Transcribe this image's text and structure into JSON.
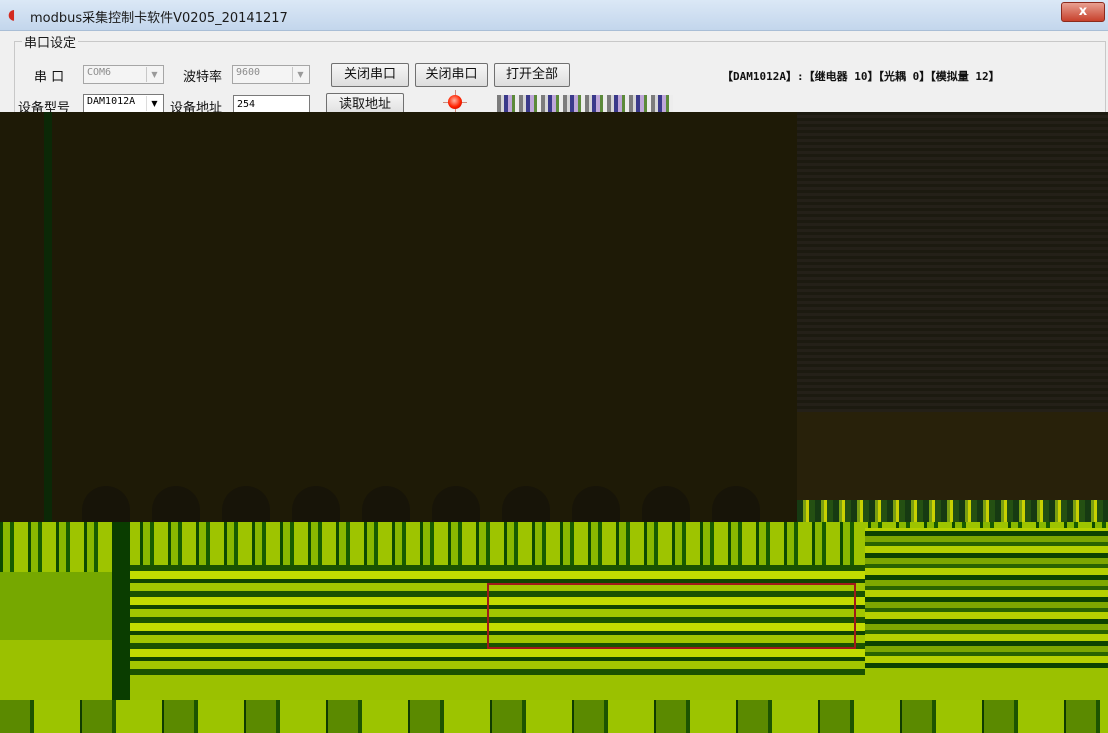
{
  "window": {
    "title": "modbus采集控制卡软件V0205_20141217",
    "close_glyph": "x"
  },
  "serial_group": {
    "title": "串口设定",
    "port_label": "串 口",
    "port_value": "COM6",
    "baud_label": "波特率",
    "baud_value": "9600",
    "button1": "关闭串口",
    "button2": "关闭串口",
    "open_all": "打开全部",
    "device_info": "【DAM1012A】:【继电器  10】【光耦 0】【模拟量 12】",
    "model_label": "设备型号",
    "model_value": "DAM1012A",
    "address_label": "设备地址",
    "address_value": "254",
    "read_address": "读取地址"
  },
  "icons": {
    "app": "modbus-app-icon",
    "status_led": "status-led-icon",
    "dropdown": "chevron-down-icon"
  },
  "colors": {
    "status_led": "#ff2200",
    "highlight_box": "#a01a1a"
  }
}
